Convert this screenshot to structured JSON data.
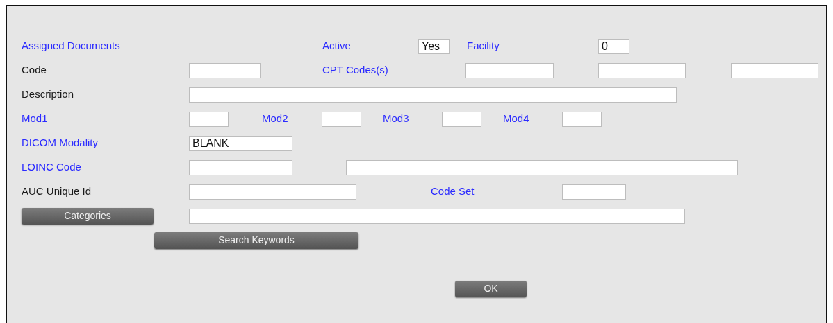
{
  "rows": [
    {
      "items": [
        {
          "kind": "label",
          "text": "Assigned Documents",
          "link": true
        },
        {
          "kind": "label",
          "text": "Active",
          "link": true
        },
        {
          "kind": "field",
          "value": "Yes"
        },
        {
          "kind": "label",
          "text": "Facility",
          "link": true
        },
        {
          "kind": "field",
          "value": "0"
        }
      ]
    },
    {
      "items": [
        {
          "kind": "label",
          "text": "Code",
          "link": false
        },
        {
          "kind": "field"
        },
        {
          "kind": "label",
          "text": "CPT Codes(s)",
          "link": true
        },
        {
          "kind": "field"
        },
        {
          "kind": "field"
        },
        {
          "kind": "field"
        }
      ]
    },
    {
      "items": [
        {
          "kind": "label",
          "text": "Description",
          "link": false
        },
        {
          "kind": "field"
        }
      ]
    },
    {
      "items": [
        {
          "kind": "label",
          "text": "Mod1",
          "link": true
        },
        {
          "kind": "field"
        },
        {
          "kind": "label",
          "text": "Mod2",
          "link": true
        },
        {
          "kind": "field"
        },
        {
          "kind": "label",
          "text": "Mod3",
          "link": true
        },
        {
          "kind": "field"
        },
        {
          "kind": "label",
          "text": "Mod4",
          "link": true
        },
        {
          "kind": "field"
        }
      ]
    },
    {
      "items": [
        {
          "kind": "label",
          "text": "DICOM Modality",
          "link": true
        },
        {
          "kind": "field",
          "value": "BLANK"
        }
      ]
    },
    {
      "items": [
        {
          "kind": "label",
          "text": "LOINC Code",
          "link": true
        },
        {
          "kind": "field"
        },
        {
          "kind": "field"
        }
      ]
    },
    {
      "items": [
        {
          "kind": "label",
          "text": "AUC Unique Id",
          "link": false
        },
        {
          "kind": "field"
        },
        {
          "kind": "label",
          "text": "Code Set",
          "link": true
        },
        {
          "kind": "field"
        }
      ]
    },
    {
      "items": [
        {
          "kind": "button",
          "text": "Categories"
        },
        {
          "kind": "field"
        }
      ]
    },
    {
      "items": [
        {
          "kind": "button",
          "text": "Search Keywords"
        }
      ]
    },
    {
      "items": [
        {
          "kind": "button",
          "text": "OK"
        }
      ]
    }
  ]
}
